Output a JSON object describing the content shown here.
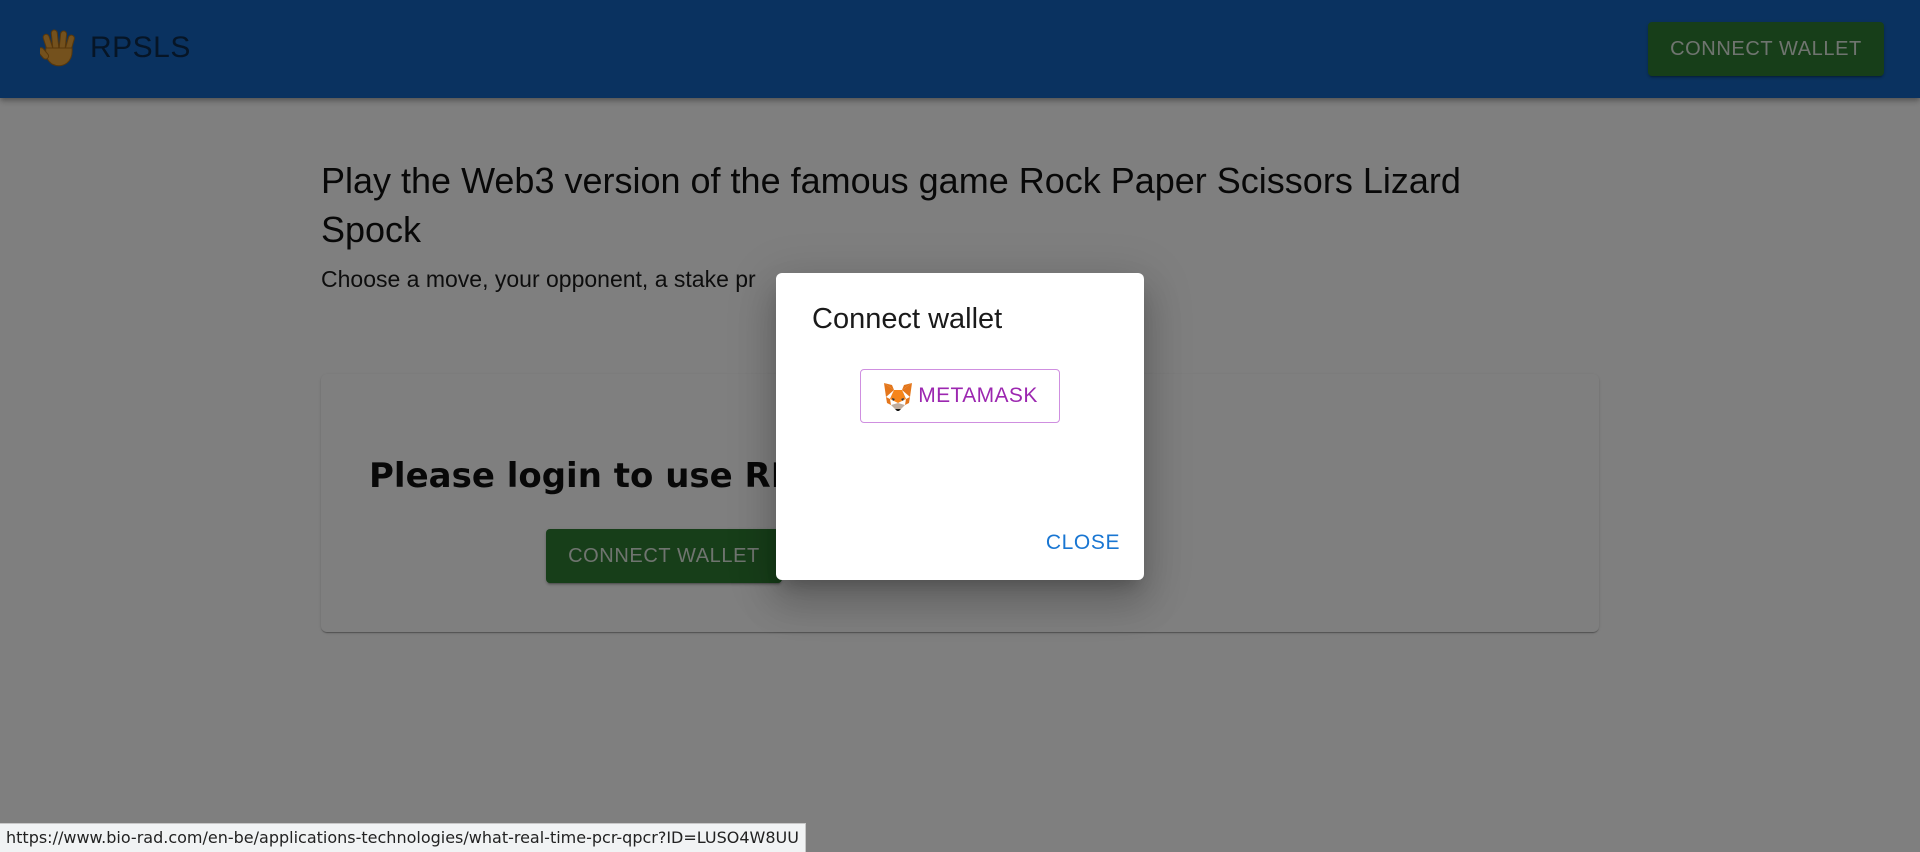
{
  "app": {
    "brand_name": "RPSLS",
    "brand_icon": "raised-hand-icon",
    "connect_wallet_label": "CONNECT WALLET"
  },
  "main": {
    "headline": "Play the Web3 version of the famous game Rock Paper Scissors Lizard Spock",
    "subline": "Choose a move, your opponent, a stake pr",
    "card": {
      "title": "Please login to use RPS",
      "connect_wallet_label": "CONNECT WALLET"
    }
  },
  "dialog": {
    "title": "Connect wallet",
    "metamask_label": "METAMASK",
    "metamask_icon": "metamask-fox-icon",
    "close_label": "CLOSE"
  },
  "status_bar": {
    "url": "https://www.bio-rad.com/en-be/applications-technologies/what-real-time-pcr-qpcr?ID=LUSO4W8UU"
  },
  "colors": {
    "appbar": "#1565c0",
    "button_green": "#2e7d32",
    "metamask_purple": "#9c27b0",
    "close_blue": "#1976d2",
    "backdrop": "rgba(0,0,0,0.5)"
  }
}
